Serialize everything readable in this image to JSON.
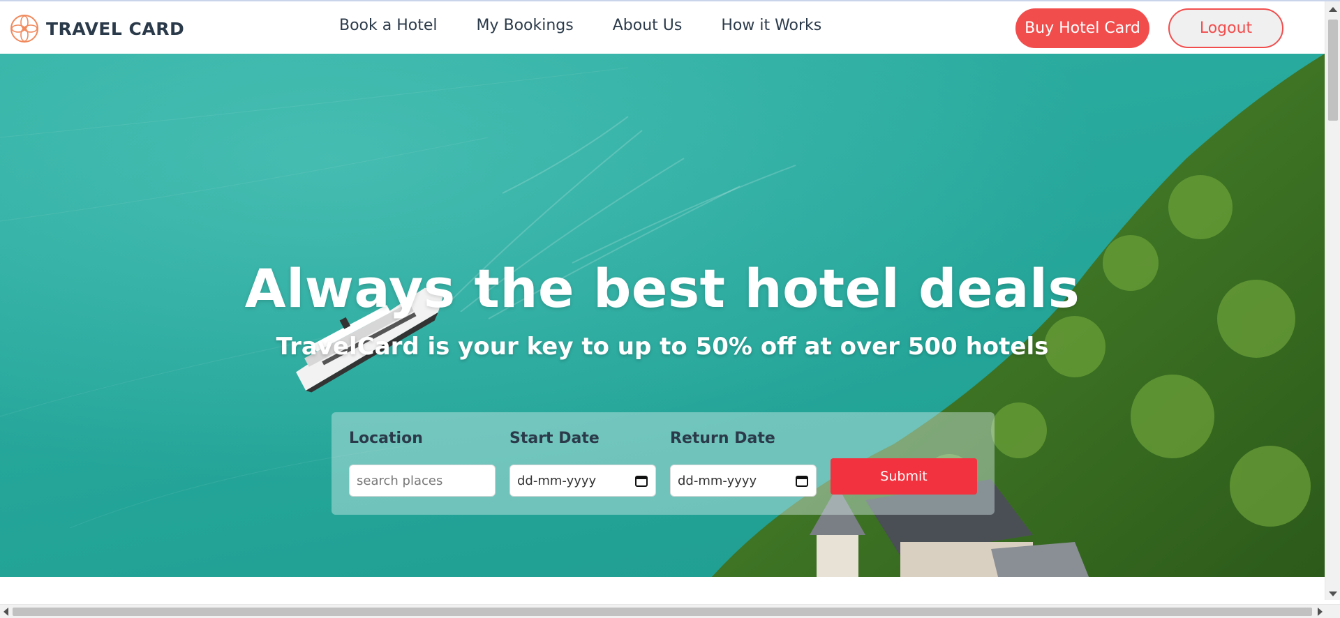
{
  "brand": {
    "name": "TRAVEL CARD",
    "accent_color": "#f24d4d",
    "text_color": "#2b3a4a"
  },
  "nav": {
    "links": [
      "Book a Hotel",
      "My Bookings",
      "About Us",
      "How it Works"
    ],
    "buy_label": "Buy Hotel Card",
    "logout_label": "Logout"
  },
  "hero": {
    "title": "Always the best hotel deals",
    "subtitle": "TravelCard is your key to up to 50% off at over 500 hotels"
  },
  "search": {
    "location_label": "Location",
    "location_placeholder": "search places",
    "start_label": "Start Date",
    "start_value": "dd-mm-yyyy",
    "return_label": "Return Date",
    "return_value": "dd-mm-yyyy",
    "submit_label": "Submit",
    "submit_color": "#f2323e"
  },
  "icons": {
    "logo": "flower-logo-icon",
    "date": "calendar-icon"
  }
}
